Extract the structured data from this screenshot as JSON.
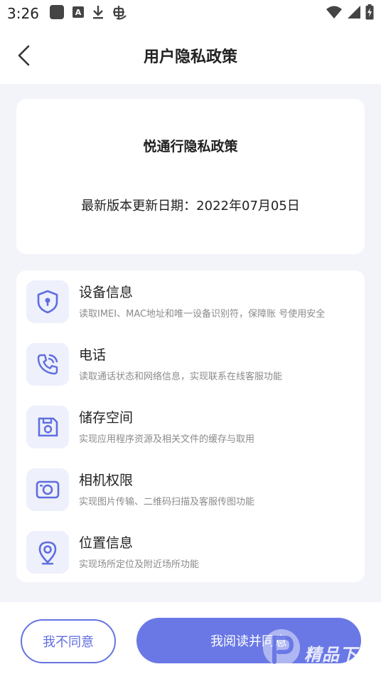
{
  "status_bar": {
    "time": "3:26",
    "left_icons": [
      "app-square-icon",
      "a-badge-icon",
      "download-icon",
      "bug-icon"
    ],
    "right_icons": [
      "wifi-icon",
      "cellular-signal-icon",
      "battery-icon"
    ]
  },
  "header": {
    "title": "用户隐私政策",
    "back_icon": "chevron-left-icon"
  },
  "policy": {
    "title": "悦通行隐私政策",
    "updated": "最新版本更新日期：2022年07月05日"
  },
  "permissions": [
    {
      "title": "设备信息",
      "desc": "读取IMEI、MAC地址和唯一设备识别符，保障账 号使用安全",
      "icon": "shield-icon"
    },
    {
      "title": "电话",
      "desc": "读取通话状态和网络信息，实现联系在线客服功能",
      "icon": "phone-icon"
    },
    {
      "title": "储存空间",
      "desc": "实现应用程序资源及相关文件的缓存与取用",
      "icon": "floppy-disk-icon"
    },
    {
      "title": "相机权限",
      "desc": "实现图片传输、二维码扫描及客服传图功能",
      "icon": "camera-icon"
    },
    {
      "title": "位置信息",
      "desc": "实现场所定位及附近场所功能",
      "icon": "location-pin-icon"
    }
  ],
  "actions": {
    "disagree": "我不同意",
    "agree": "我阅读并同意"
  },
  "watermark": {
    "text": "精品下载",
    "url": "www.jpxz.net"
  },
  "colors": {
    "accent": "#6a78e6",
    "icon_bg": "#eef0fb",
    "page_bg": "#f3f4f9"
  }
}
